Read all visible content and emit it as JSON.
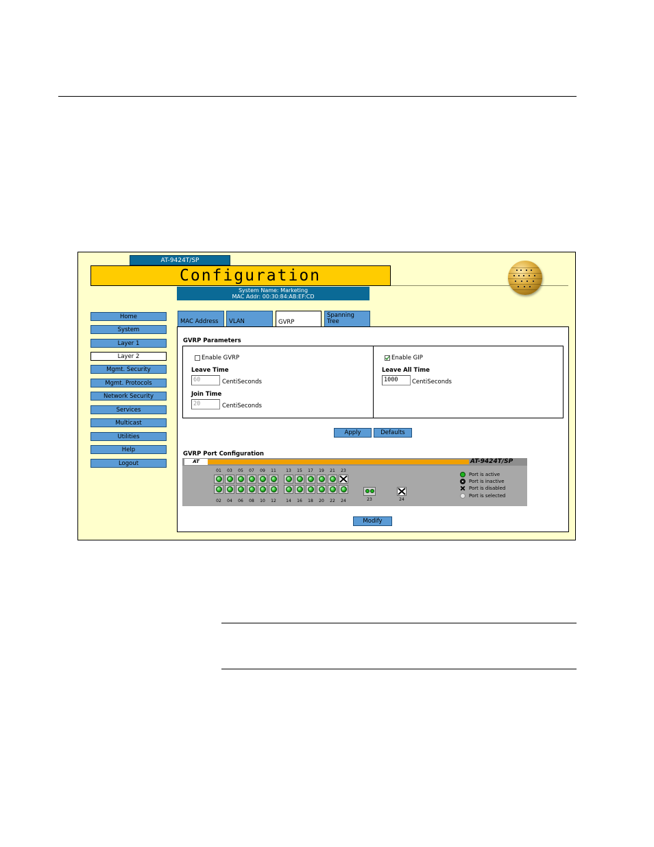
{
  "header": {
    "model_tab": "AT-9424T/SP",
    "title": "Configuration",
    "system_name": "System Name: Marketing",
    "mac_addr": "MAC Addr: 00:30:84:AB:EF:CD"
  },
  "sidebar": {
    "items": [
      {
        "label": "Home"
      },
      {
        "label": "System"
      },
      {
        "label": "Layer 1"
      },
      {
        "label": "Layer 2",
        "active": true
      },
      {
        "label": "Mgmt. Security"
      },
      {
        "label": "Mgmt. Protocols"
      },
      {
        "label": "Network Security"
      },
      {
        "label": "Services"
      },
      {
        "label": "Multicast"
      },
      {
        "label": "Utilities"
      },
      {
        "label": "Help"
      },
      {
        "label": "Logout"
      }
    ]
  },
  "tabs": [
    {
      "label": "MAC Address"
    },
    {
      "label": "VLAN"
    },
    {
      "label": "GVRP",
      "active": true
    },
    {
      "label": "Spanning Tree"
    }
  ],
  "gvrp_params": {
    "heading": "GVRP Parameters",
    "enable_gvrp_label": "Enable GVRP",
    "enable_gvrp_checked": false,
    "enable_gip_label": "Enable GIP",
    "enable_gip_checked": true,
    "leave_time_label": "Leave Time",
    "leave_time_value": "60",
    "join_time_label": "Join Time",
    "join_time_value": "20",
    "leave_all_label": "Leave All Time",
    "leave_all_value": "1000",
    "unit": "CentiSeconds",
    "apply_label": "Apply",
    "defaults_label": "Defaults"
  },
  "port_config": {
    "heading": "GVRP Port Configuration",
    "switch_logo": "AT",
    "switch_name": "AT-9424T/SP",
    "top_numbers": [
      "01",
      "03",
      "05",
      "07",
      "09",
      "11",
      "13",
      "15",
      "17",
      "19",
      "21",
      "23"
    ],
    "bottom_numbers": [
      "02",
      "04",
      "06",
      "08",
      "10",
      "12",
      "14",
      "16",
      "18",
      "20",
      "22",
      "24"
    ],
    "uplink_23": "23",
    "uplink_24": "24",
    "legend": {
      "active": "Port is active",
      "inactive": "Port is inactive",
      "disabled": "Port is disabled",
      "selected": "Port is selected"
    },
    "modify_label": "Modify"
  },
  "colors": {
    "title_bar": "#ffcc00",
    "frame_bg": "#ffffcc",
    "nav_button": "#5b9bd5",
    "info_bar": "#0b6a96",
    "switch_stripe": "#f0a000",
    "port_active": "#1fb51f"
  }
}
